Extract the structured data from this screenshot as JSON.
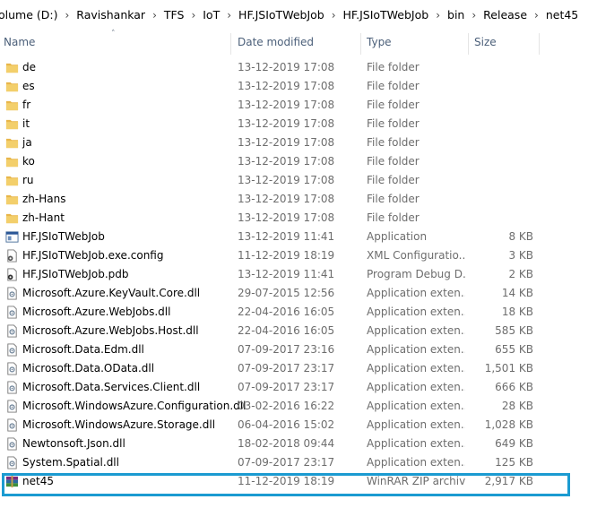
{
  "breadcrumb": [
    "olume (D:)",
    "Ravishankar",
    "TFS",
    "IoT",
    "HF.JSIoTWebJob",
    "HF.JSIoTWebJob",
    "bin",
    "Release",
    "net45"
  ],
  "columns": {
    "name": "Name",
    "date": "Date modified",
    "type": "Type",
    "size": "Size"
  },
  "files": [
    {
      "icon": "folder-icon",
      "name": "de",
      "date": "13-12-2019 17:08",
      "type": "File folder",
      "size": ""
    },
    {
      "icon": "folder-icon",
      "name": "es",
      "date": "13-12-2019 17:08",
      "type": "File folder",
      "size": ""
    },
    {
      "icon": "folder-icon",
      "name": "fr",
      "date": "13-12-2019 17:08",
      "type": "File folder",
      "size": ""
    },
    {
      "icon": "folder-icon",
      "name": "it",
      "date": "13-12-2019 17:08",
      "type": "File folder",
      "size": ""
    },
    {
      "icon": "folder-icon",
      "name": "ja",
      "date": "13-12-2019 17:08",
      "type": "File folder",
      "size": ""
    },
    {
      "icon": "folder-icon",
      "name": "ko",
      "date": "13-12-2019 17:08",
      "type": "File folder",
      "size": ""
    },
    {
      "icon": "folder-icon",
      "name": "ru",
      "date": "13-12-2019 17:08",
      "type": "File folder",
      "size": ""
    },
    {
      "icon": "folder-icon",
      "name": "zh-Hans",
      "date": "13-12-2019 17:08",
      "type": "File folder",
      "size": ""
    },
    {
      "icon": "folder-icon",
      "name": "zh-Hant",
      "date": "13-12-2019 17:08",
      "type": "File folder",
      "size": ""
    },
    {
      "icon": "application-icon",
      "name": "HF.JSIoTWebJob",
      "date": "13-12-2019 11:41",
      "type": "Application",
      "size": "8 KB"
    },
    {
      "icon": "config-file-icon",
      "name": "HF.JSIoTWebJob.exe.config",
      "date": "11-12-2019 18:19",
      "type": "XML Configuratio...",
      "size": "3 KB"
    },
    {
      "icon": "pdb-file-icon",
      "name": "HF.JSIoTWebJob.pdb",
      "date": "13-12-2019 11:41",
      "type": "Program Debug D...",
      "size": "2 KB"
    },
    {
      "icon": "dll-icon",
      "name": "Microsoft.Azure.KeyVault.Core.dll",
      "date": "29-07-2015 12:56",
      "type": "Application exten...",
      "size": "14 KB"
    },
    {
      "icon": "dll-icon",
      "name": "Microsoft.Azure.WebJobs.dll",
      "date": "22-04-2016 16:05",
      "type": "Application exten...",
      "size": "18 KB"
    },
    {
      "icon": "dll-icon",
      "name": "Microsoft.Azure.WebJobs.Host.dll",
      "date": "22-04-2016 16:05",
      "type": "Application exten...",
      "size": "585 KB"
    },
    {
      "icon": "dll-icon",
      "name": "Microsoft.Data.Edm.dll",
      "date": "07-09-2017 23:16",
      "type": "Application exten...",
      "size": "655 KB"
    },
    {
      "icon": "dll-icon",
      "name": "Microsoft.Data.OData.dll",
      "date": "07-09-2017 23:17",
      "type": "Application exten...",
      "size": "1,501 KB"
    },
    {
      "icon": "dll-icon",
      "name": "Microsoft.Data.Services.Client.dll",
      "date": "07-09-2017 23:17",
      "type": "Application exten...",
      "size": "666 KB"
    },
    {
      "icon": "dll-icon",
      "name": "Microsoft.WindowsAzure.Configuration.dll",
      "date": "03-02-2016 16:22",
      "type": "Application exten...",
      "size": "28 KB"
    },
    {
      "icon": "dll-icon",
      "name": "Microsoft.WindowsAzure.Storage.dll",
      "date": "06-04-2016 15:02",
      "type": "Application exten...",
      "size": "1,028 KB"
    },
    {
      "icon": "dll-icon",
      "name": "Newtonsoft.Json.dll",
      "date": "18-02-2018 09:44",
      "type": "Application exten...",
      "size": "649 KB"
    },
    {
      "icon": "dll-icon",
      "name": "System.Spatial.dll",
      "date": "07-09-2017 23:17",
      "type": "Application exten...",
      "size": "125 KB"
    },
    {
      "icon": "winrar-zip-icon",
      "name": "net45",
      "date": "11-12-2019 18:19",
      "type": "WinRAR ZIP archive",
      "size": "2,917 KB"
    }
  ],
  "colors": {
    "highlight": "#1b9bd1",
    "folder": "#e8b64a",
    "header_text": "#4c607a",
    "meta_text": "#6d6d6d"
  }
}
